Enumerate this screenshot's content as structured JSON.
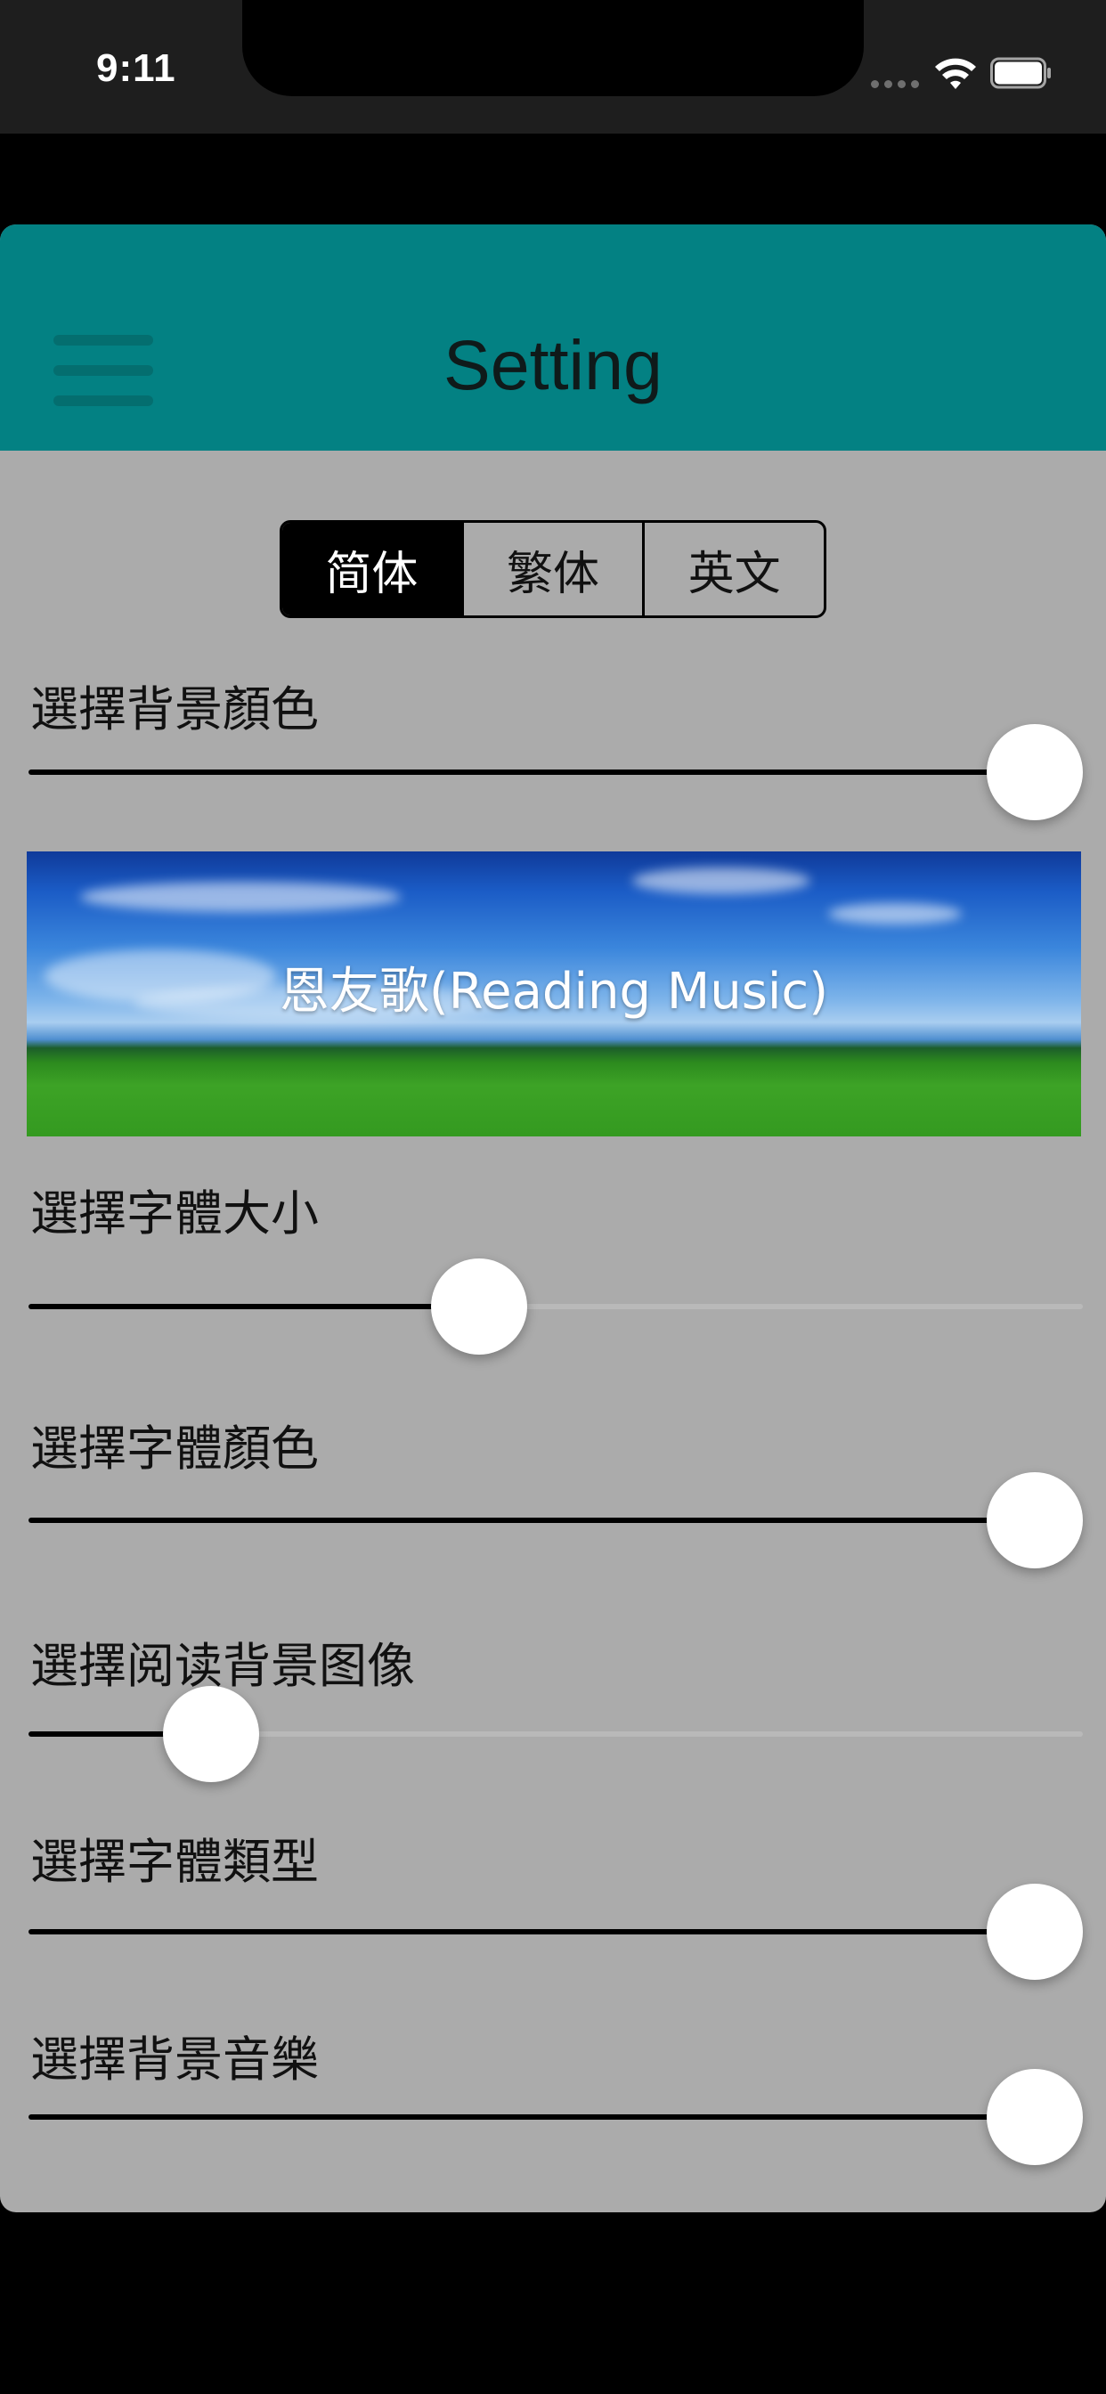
{
  "status_bar": {
    "time": "9:11",
    "icons": [
      "signal-icon",
      "wifi-icon",
      "battery-icon"
    ]
  },
  "nav": {
    "title": "Setting",
    "menu_icon": "hamburger-menu-icon"
  },
  "language_segments": {
    "options": [
      "简体",
      "繁体",
      "英文"
    ],
    "selected": "简体"
  },
  "banner": {
    "title": "恩友歌(Reading Music)"
  },
  "settings": [
    {
      "label": "選擇背景顏色",
      "value_fraction": 1.0
    },
    {
      "label": "選擇字體大小",
      "value_fraction": 0.42
    },
    {
      "label": "選擇字體顏色",
      "value_fraction": 1.0
    },
    {
      "label": "選擇阅读背景图像",
      "value_fraction": 0.14
    },
    {
      "label": "選擇字體類型",
      "value_fraction": 1.0
    },
    {
      "label": "選擇背景音樂",
      "value_fraction": 1.0
    }
  ],
  "colors": {
    "nav_background": "#038183",
    "content_background": "#ababab",
    "slider_fill": "#000000",
    "slider_track": "#b9b9b9"
  }
}
